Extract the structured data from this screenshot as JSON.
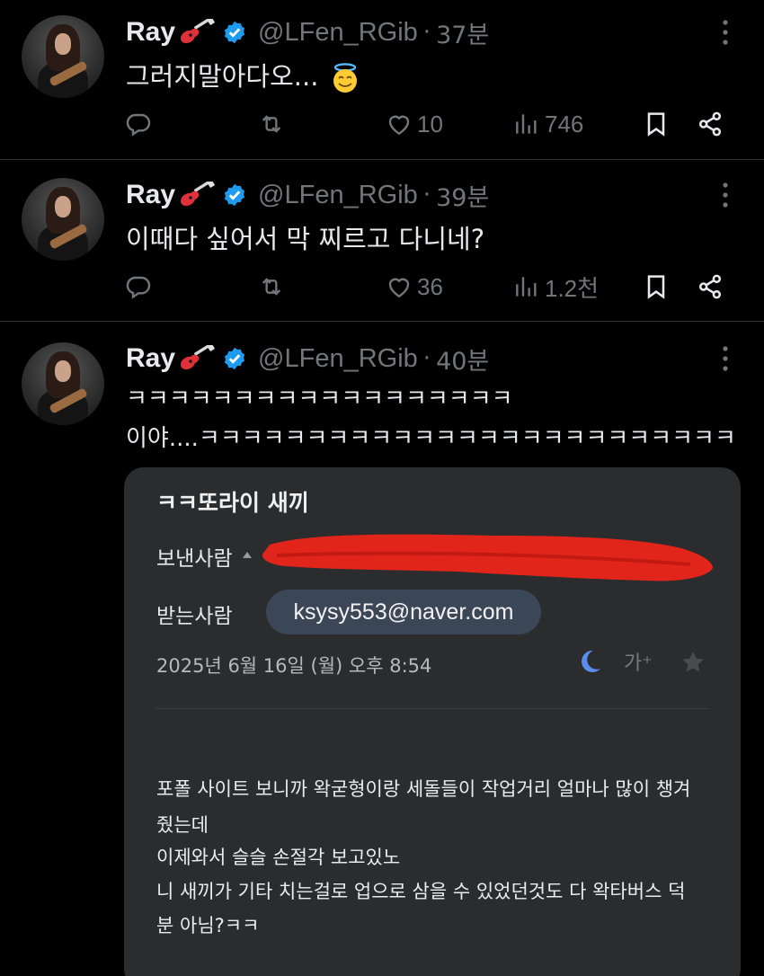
{
  "user": {
    "name": "Ray",
    "handle": "@LFen_RGib",
    "separator": "·"
  },
  "tweets": [
    {
      "time": "37분",
      "text_lines": [
        "그러지말아다오..."
      ],
      "stats": {
        "reply": "",
        "retweet": "",
        "like": "10",
        "views": "746"
      }
    },
    {
      "time": "39분",
      "text_lines": [
        "이때다 싶어서 막 찌르고 다니네?"
      ],
      "stats": {
        "reply": "",
        "retweet": "",
        "like": "36",
        "views": "1.2천"
      }
    },
    {
      "time": "40분",
      "text_lines": [
        "ㅋㅋㅋㅋㅋㅋㅋㅋㅋㅋㅋㅋㅋㅋㅋㅋㅋㅋ",
        "이야....ㅋㅋㅋㅋㅋㅋㅋㅋㅋㅋㅋㅋㅋㅋㅋㅋㅋㅋㅋㅋㅋㅋㅋㅋㅋ"
      ]
    }
  ],
  "email": {
    "subject": "ㅋㅋ또라이 새끼",
    "from_label": "보낸사람",
    "to_label": "받는사람",
    "to_address": "ksysy553@naver.com",
    "date": "2025년 6월 16일 (월) 오후 8:54",
    "text_size_label": "가⁺",
    "body_lines": [
      "포폴 사이트 보니까 왁굳형이랑 세돌들이 작업거리 얼마나 많이 챙겨",
      "줬는데",
      "이제와서 슬슬 손절각 보고있노",
      "니 새끼가 기타 치는걸로 업으로 삼을 수 있었던것도 다 왁타버스 덕",
      "분 아님?ㅋㅋ"
    ]
  },
  "colors": {
    "background": "#000000",
    "text": "#e7e9ea",
    "muted": "#71767b",
    "verified": "#1d9bf0",
    "email_card": "#2b2c2e",
    "recipient_chip": "#3b4656",
    "redaction": "#e1251b",
    "moon": "#5b8df0"
  },
  "icons": [
    "guitar-emoji",
    "verified-badge-icon",
    "more-icon",
    "halo-emoji",
    "reply-icon",
    "retweet-icon",
    "like-icon",
    "views-icon",
    "bookmark-icon",
    "share-icon",
    "moon-icon",
    "star-icon"
  ]
}
